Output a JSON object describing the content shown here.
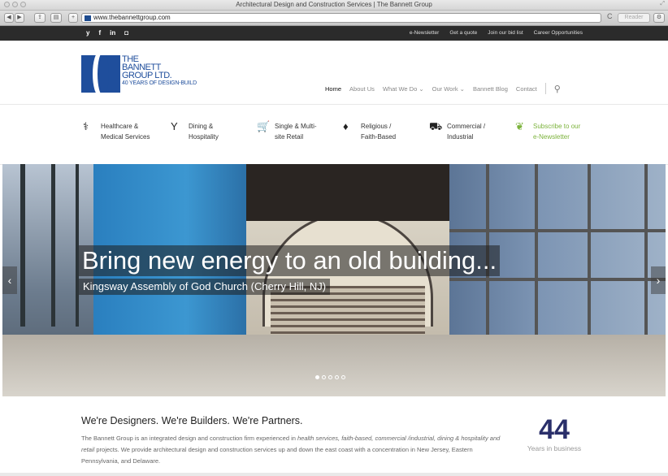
{
  "browser": {
    "window_title": "Architectural Design and Construction Services | The Bannett Group",
    "url": "www.thebannettgroup.com",
    "reader_label": "Reader",
    "back": "◀",
    "forward": "▶",
    "share": "⇪",
    "bookmarks": "▤",
    "add": "+",
    "reload": "C",
    "settings": "⚙",
    "resize": "⤢"
  },
  "topbar": {
    "social": [
      "y",
      "f",
      "in",
      "◘"
    ],
    "links": [
      "e-Newsletter",
      "Get a quote",
      "Join our bid list",
      "Career Opportunities"
    ]
  },
  "logo": {
    "line1": "THE",
    "line2": "BANNETT",
    "line3": "GROUP LTD.",
    "line4": "40 YEARS OF DESIGN-BUILD"
  },
  "nav": {
    "items": [
      "Home",
      "About Us",
      "What We Do ⌄",
      "Our Work ⌄",
      "Bannett Blog",
      "Contact"
    ],
    "search": "⚲"
  },
  "categories": [
    {
      "icon": "⚕",
      "line1": "Healthcare &",
      "line2": "Medical Services"
    },
    {
      "icon": "Y",
      "line1": "Dining &",
      "line2": "Hospitality"
    },
    {
      "icon": "🛒",
      "line1": "Single & Multi-",
      "line2": "site Retail"
    },
    {
      "icon": "♦",
      "line1": "Religious /",
      "line2": "Faith-Based"
    },
    {
      "icon": "⛟",
      "line1": "Commercial /",
      "line2": "Industrial"
    },
    {
      "icon": "❦",
      "line1": "Subscribe to our",
      "line2": "e-Newsletter"
    }
  ],
  "hero": {
    "headline": "Bring new energy to an old building...",
    "subtitle": "Kingsway Assembly of God Church (Cherry Hill, NJ)",
    "prev": "‹",
    "next": "›",
    "slides_total": 5,
    "active_slide": 1
  },
  "intro": {
    "heading": "We're Designers.  We're Builders.  We're Partners.",
    "p_start": "The Bannett Group is an integrated design and construction firm experienced in ",
    "p_em1": "health services, faith-based, commercial /industrial, dining & hospitality and retail",
    "p_end": " projects. We provide architectural design and construction services up and down the east coast with a concentration in New Jersey, Eastern Pennsylvania, and Delaware."
  },
  "counter": {
    "value": "44",
    "label": "Years in business"
  },
  "colors": {
    "brand_blue": "#1f4e9c",
    "accent_green": "#7cb33c",
    "counter_navy": "#2a2f6a"
  }
}
